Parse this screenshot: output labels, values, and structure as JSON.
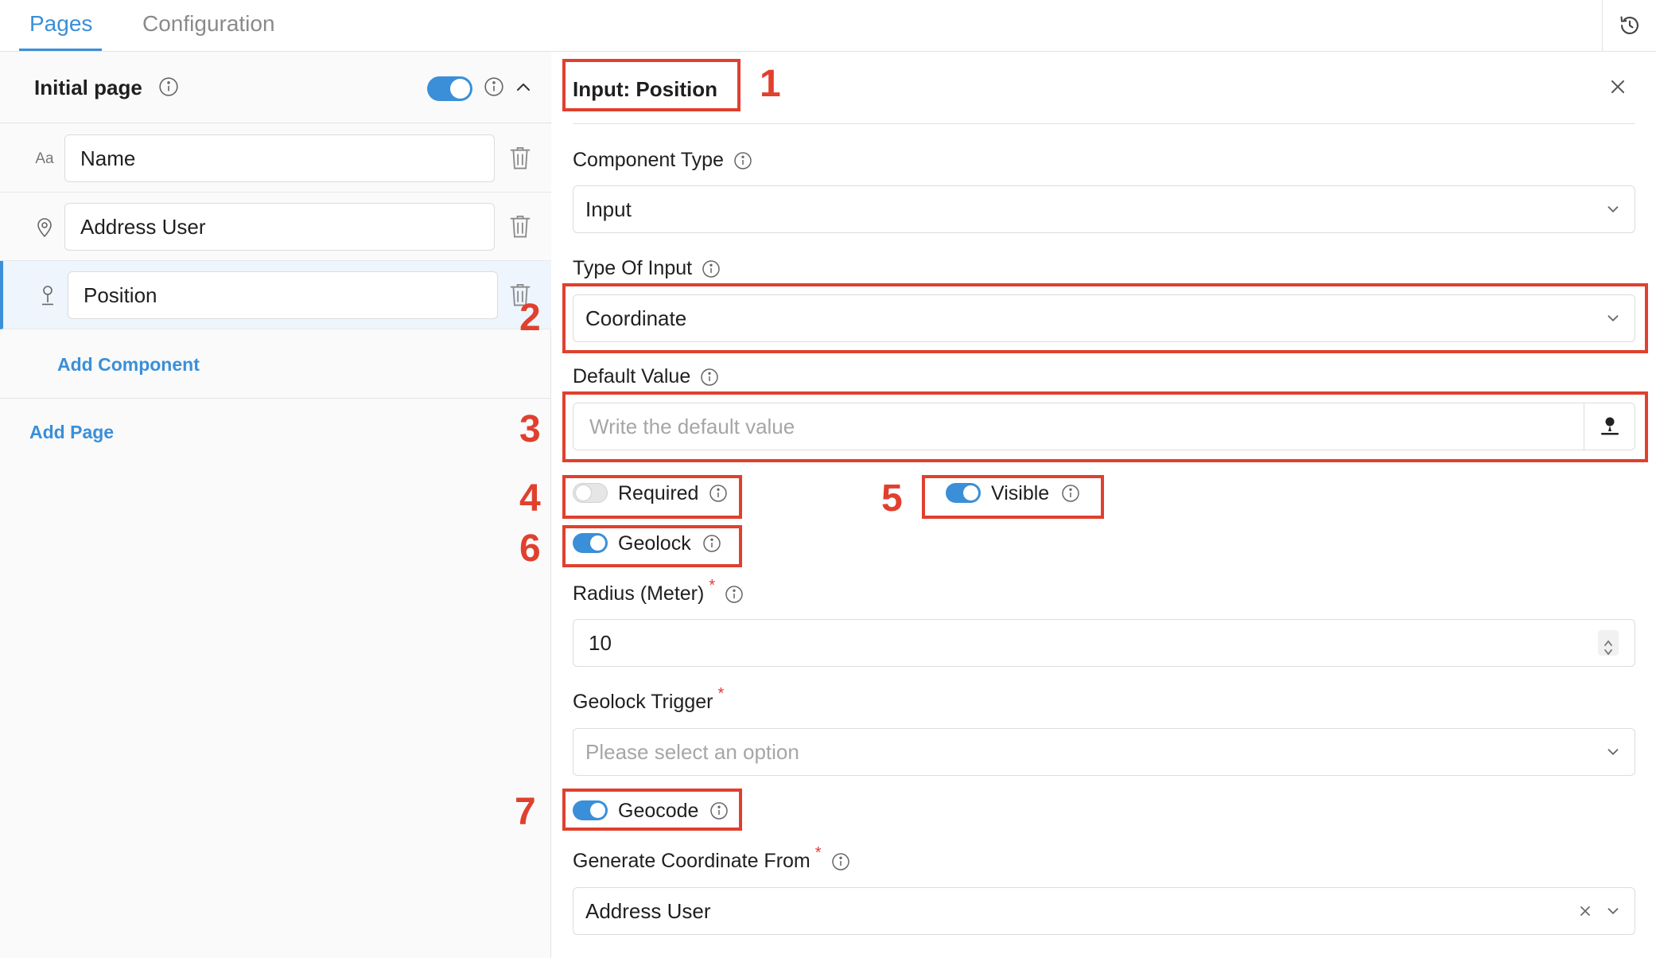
{
  "tabs": [
    {
      "label": "Pages",
      "active": true
    },
    {
      "label": "Configuration",
      "active": false
    }
  ],
  "accent_color": "#3a8fd8",
  "annotation_color": "#e0402e",
  "left": {
    "page_title": "Initial page",
    "page_enabled": true,
    "components": [
      {
        "icon": "text-icon",
        "icon_text": "Aa",
        "value": "Name",
        "selected": false
      },
      {
        "icon": "location-pin-icon",
        "value": "Address User",
        "selected": false
      },
      {
        "icon": "position-pin-icon",
        "value": "Position",
        "selected": true
      }
    ],
    "add_component_label": "Add Component",
    "add_page_label": "Add Page"
  },
  "right": {
    "title": "Input: Position",
    "component_type": {
      "label": "Component Type",
      "value": "Input"
    },
    "type_of_input": {
      "label": "Type Of Input",
      "value": "Coordinate"
    },
    "default_value": {
      "label": "Default Value",
      "placeholder": "Write the default value"
    },
    "required": {
      "label": "Required",
      "on": false
    },
    "visible": {
      "label": "Visible",
      "on": true
    },
    "geolock": {
      "label": "Geolock",
      "on": true
    },
    "radius": {
      "label": "Radius (Meter)",
      "required_mark": "*",
      "value": "10"
    },
    "geolock_trigger": {
      "label": "Geolock Trigger",
      "required_mark": "*",
      "placeholder": "Please select an option"
    },
    "geocode": {
      "label": "Geocode",
      "on": true
    },
    "generate_from": {
      "label": "Generate Coordinate From",
      "required_mark": "*",
      "value": "Address User"
    }
  },
  "annotations": [
    "1",
    "2",
    "3",
    "4",
    "5",
    "6",
    "7"
  ]
}
